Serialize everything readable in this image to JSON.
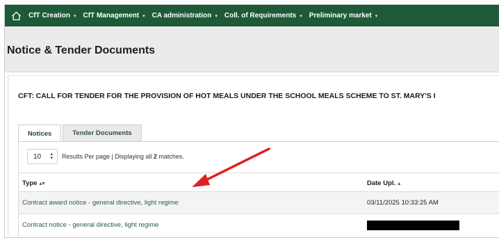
{
  "nav": {
    "items": [
      {
        "label": "CfT Creation"
      },
      {
        "label": "CfT Management"
      },
      {
        "label": "CA administration"
      },
      {
        "label": "Coll. of Requirements"
      },
      {
        "label": "Preliminary market"
      }
    ],
    "caret": "▾",
    "colors": {
      "background": "#1e5a3a",
      "text": "#ffffff"
    }
  },
  "page": {
    "title": "Notice & Tender Documents"
  },
  "cft": {
    "title": "CFT: CALL FOR TENDER FOR THE PROVISION OF HOT MEALS UNDER THE SCHOOL MEALS SCHEME TO ST. MARY'S I"
  },
  "tabs": [
    {
      "label": "Notices",
      "active": true
    },
    {
      "label": "Tender Documents",
      "active": false
    }
  ],
  "pager": {
    "per_page_value": "10",
    "text_before": "Results Per page | Displaying all ",
    "count": "2",
    "text_after": " matches."
  },
  "table": {
    "columns": [
      {
        "label": "Type",
        "sort": "▴▾"
      },
      {
        "label": "Date Upl.",
        "sort": "▴"
      }
    ],
    "rows": [
      {
        "type": "Contract award notice - general directive, light regime",
        "date": "03/11/2025 10:33:25 AM",
        "redacted": false
      },
      {
        "type": "Contract notice - general directive, light regime",
        "date": "",
        "redacted": true
      }
    ]
  },
  "annotation": {
    "color": "#e02020",
    "icon": "red-arrow"
  }
}
